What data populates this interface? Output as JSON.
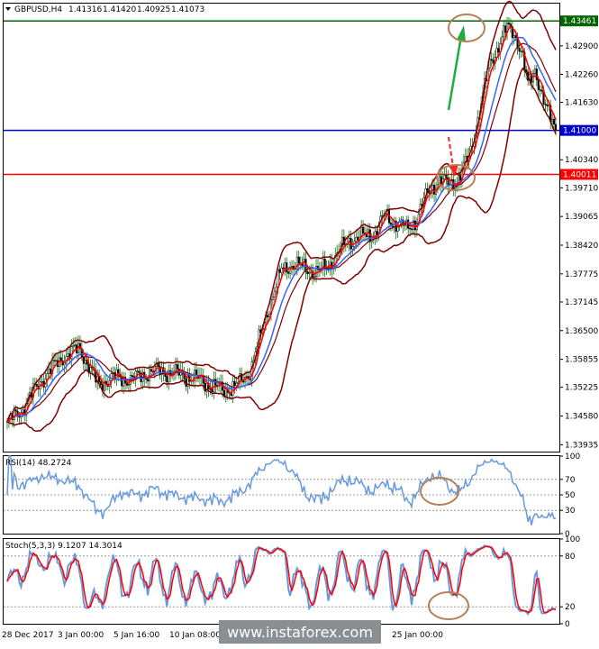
{
  "chart_data": [
    {
      "type": "candlestick",
      "header": {
        "symbol_tf": "GBPUSD,H4",
        "open": "1.41316",
        "high": "1.41420",
        "low": "1.40925",
        "close": "1.41073"
      },
      "y_ticks": [
        "1.42900",
        "1.42260",
        "1.41630",
        "1.40340",
        "1.39710",
        "1.39065",
        "1.38420",
        "1.37775",
        "1.37145",
        "1.36500",
        "1.35855",
        "1.35225",
        "1.34580",
        "1.33935"
      ],
      "ylim": [
        1.3378,
        1.4385
      ],
      "levels": [
        {
          "value": 1.43461,
          "label": "1.43461",
          "color": "#006400"
        },
        {
          "value": 1.41,
          "label": "1.41000",
          "color": "#0000cc"
        },
        {
          "value": 1.40011,
          "label": "1.40011",
          "color": "#ff0000"
        }
      ],
      "indicators": {
        "bollinger_color": "#800000",
        "ma_fast_color": "#ff0000",
        "ma_slow_color": "#3366ff"
      },
      "annotations": [
        {
          "type": "arrow",
          "direction": "up",
          "color": "#22aa44"
        },
        {
          "type": "arrow",
          "direction": "down",
          "color": "#ff2222",
          "dashed": true
        },
        {
          "type": "circle",
          "color": "#b5805a",
          "where": "upper target"
        },
        {
          "type": "circle",
          "color": "#b5805a",
          "where": "lower target"
        }
      ]
    },
    {
      "type": "line",
      "header": "RSI(14) 48.2724",
      "y_ticks": [
        "100",
        "70",
        "50",
        "30",
        "0"
      ],
      "ylim": [
        0,
        100
      ],
      "series_color": "#6699dd"
    },
    {
      "type": "line",
      "header": "Stoch(5,3,3) 9.1207 14.3014",
      "y_ticks": [
        "100",
        "80",
        "20",
        "0"
      ],
      "ylim": [
        0,
        100
      ],
      "series": [
        {
          "color": "#6699dd"
        },
        {
          "color": "#ff0000"
        }
      ]
    }
  ],
  "x_ticks": [
    "28 Dec 2017",
    "3 Jan 00:00",
    "5 Jan 16:00",
    "10 Jan 08:00",
    "25 Jan 00:00"
  ],
  "watermark": "www.instaforex.com"
}
